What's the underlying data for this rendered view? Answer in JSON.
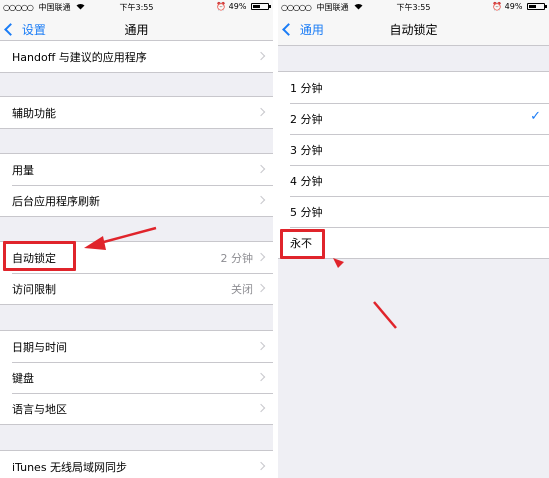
{
  "left": {
    "status": {
      "carrier": "中国联通",
      "signal": "○○○○○",
      "time": "下午3:55",
      "battery": "49%"
    },
    "nav": {
      "back_label": "设置",
      "title": "通用"
    },
    "groups": [
      [
        "Handoff 与建议的应用程序"
      ],
      [
        "辅助功能"
      ],
      [
        "用量",
        "后台应用程序刷新"
      ],
      [
        "自动锁定",
        "访问限制"
      ],
      [
        "日期与时间",
        "键盘",
        "语言与地区"
      ],
      [
        "iTunes 无线局域网同步"
      ]
    ],
    "values": {
      "auto_lock": "2 分钟",
      "restrictions": "关闭"
    }
  },
  "right": {
    "status": {
      "carrier": "中国联通",
      "signal": "○○○○○",
      "time": "下午3:55",
      "battery": "49%"
    },
    "nav": {
      "back_label": "通用",
      "title": "自动锁定"
    },
    "options": [
      "1 分钟",
      "2 分钟",
      "3 分钟",
      "4 分钟",
      "5 分钟",
      "永不"
    ],
    "selected_index": 1
  },
  "colors": {
    "accent": "#1a7cf6",
    "annotation": "#e0242b",
    "background": "#efeff4"
  }
}
